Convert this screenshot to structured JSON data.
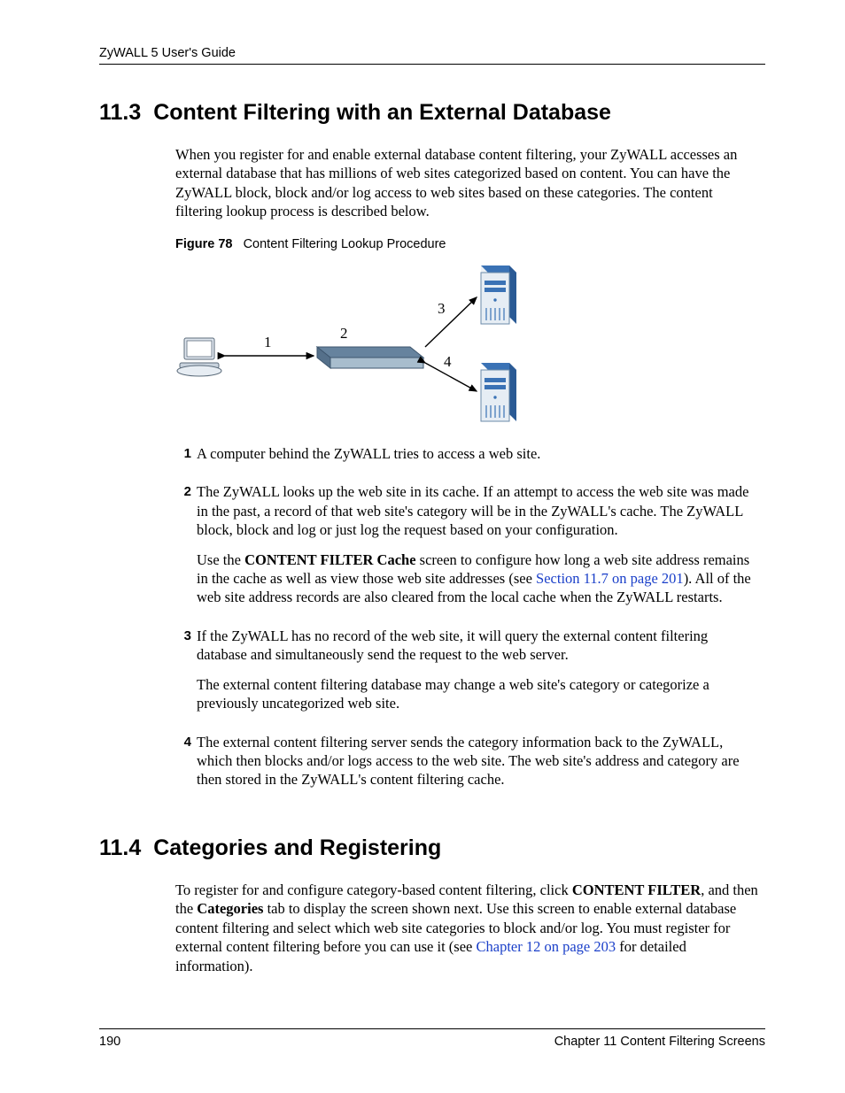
{
  "header": {
    "running_title": "ZyWALL 5 User's Guide"
  },
  "section113": {
    "number": "11.3",
    "title": "Content Filtering with an External Database",
    "intro": "When you register for and enable external database content filtering, your ZyWALL accesses an external database that has millions of web sites categorized based on content. You can have the ZyWALL block, block and/or log access to web sites based on these categories. The content filtering lookup process is described below.",
    "figure": {
      "label": "Figure 78",
      "caption": "Content Filtering Lookup Procedure",
      "labels": {
        "l1": "1",
        "l2": "2",
        "l3": "3",
        "l4": "4"
      }
    },
    "steps": [
      {
        "num": "1",
        "paras": [
          "A computer behind the ZyWALL tries to access a web site."
        ]
      },
      {
        "num": "2",
        "paras": [
          "The ZyWALL looks up the web site in its cache. If an attempt to access the web site was made in the past, a record of that web site's category will be in the ZyWALL's cache. The ZyWALL block, block and log or just log the request based on your configuration.",
          "__cache_para__"
        ]
      },
      {
        "num": "3",
        "paras": [
          "If the ZyWALL has no record of the web site, it will query the external content filtering database and simultaneously send the request to the web server.",
          "The external content filtering database may change a web site's category or categorize a previously uncategorized web site."
        ]
      },
      {
        "num": "4",
        "paras": [
          "The external content filtering server sends the category information back to the ZyWALL, which then blocks and/or logs access to the web site. The web site's address and category are then stored in the ZyWALL's content filtering cache."
        ]
      }
    ],
    "cache_para": {
      "t1": "Use the ",
      "b1": "CONTENT FILTER Cache",
      "t2": " screen to configure how long a web site address remains in the cache as well as view those web site addresses (see ",
      "link": "Section 11.7 on page 201",
      "t3": "). All of the web site address records are also cleared from the local cache when the ZyWALL restarts."
    }
  },
  "section114": {
    "number": "11.4",
    "title": "Categories and Registering",
    "para": {
      "t1": "To register for and configure category-based content filtering, click ",
      "b1": "CONTENT FILTER",
      "t2": ", and then the ",
      "b2": "Categories",
      "t3": " tab to display the screen shown next. Use this screen to enable external database content filtering and select which web site categories to block and/or log. You must register for external content filtering before you can use it (see ",
      "link": "Chapter 12 on page 203",
      "t4": " for detailed information)."
    }
  },
  "footer": {
    "page_number": "190",
    "chapter": "Chapter 11 Content Filtering Screens"
  }
}
